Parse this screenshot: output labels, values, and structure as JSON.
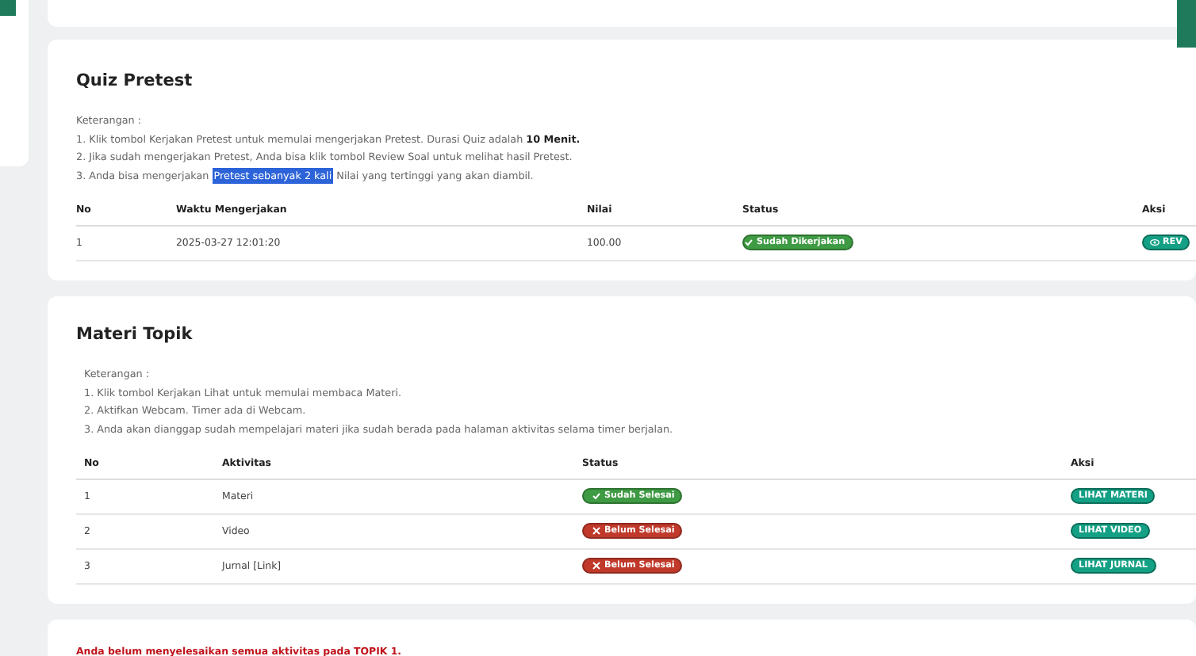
{
  "sections": [
    {
      "title": "Quiz Pretest",
      "note_label": "Keterangan :",
      "notes": [
        [
          {
            "text": "1. Klik tombol Kerjakan Pretest untuk memulai mengerjakan Pretest. Durasi Quiz adalah **10 Menit.**",
            "selected": false
          }
        ],
        [
          {
            "text": "2. Jika sudah mengerjakan Pretest, Anda bisa klik tombol Review Soal untuk melihat hasil Pretest.",
            "selected": false
          }
        ],
        [
          {
            "text": "3. Anda bisa mengerjakan",
            "selected": false
          },
          {
            "text": "Pretest sebanyak 2 kali",
            "selected": true
          },
          {
            "text": "Nilai yang tertinggi yang akan diambil.",
            "selected": false
          }
        ]
      ],
      "columns": [
        "No",
        "Waktu Mengerjakan",
        "Nilai",
        "Status",
        "Aksi"
      ],
      "rows": [
        {
          "cells": [
            "1",
            "2025-03-27 12:01:20",
            "100.00"
          ],
          "status": {
            "text": "Sudah Dikerjakan",
            "done": true
          },
          "action": {
            "text": "REV",
            "kind": "review"
          }
        }
      ]
    },
    {
      "title": "Materi Topik",
      "note_label": "Keterangan :",
      "notes": [
        [
          {
            "text": "1. Klik tombol Kerjakan Lihat untuk memulai membaca Materi.",
            "selected": false
          }
        ],
        [
          {
            "text": "2. Aktifkan Webcam. Timer ada di Webcam.",
            "selected": false
          }
        ],
        [
          {
            "text": "3. Anda akan dianggap sudah mempelajari materi jika sudah berada pada halaman aktivitas selama timer berjalan.",
            "selected": false
          }
        ]
      ],
      "columns": [
        "No",
        "Aktivitas",
        "Status",
        "Aksi"
      ],
      "rows": [
        {
          "cells": [
            "1",
            "Materi"
          ],
          "status": {
            "text": "Sudah Selesai",
            "done": true
          },
          "action": {
            "text": "LIHAT MATERI",
            "kind": "view"
          }
        },
        {
          "cells": [
            "2",
            "Video"
          ],
          "status": {
            "text": "Belum Selesai",
            "done": false
          },
          "action": {
            "text": "LIHAT VIDEO",
            "kind": "view"
          }
        },
        {
          "cells": [
            "3",
            "Jurnal [Link]"
          ],
          "status": {
            "text": "Belum Selesai",
            "done": false
          },
          "action": {
            "text": "LIHAT JURNAL",
            "kind": "view"
          }
        }
      ]
    }
  ],
  "warning": "Anda belum menyelesaikan semua aktivitas pada TOPIK 1."
}
